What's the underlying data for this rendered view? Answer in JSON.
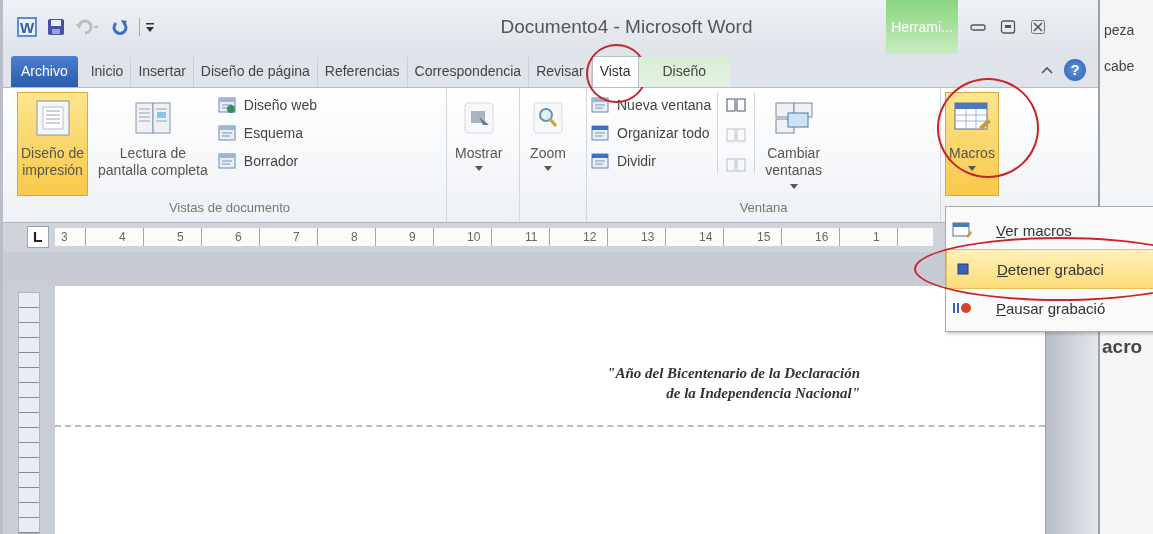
{
  "window": {
    "title": "Documento4 - Microsoft Word",
    "app_icon_letter": "W"
  },
  "contextual_tab_group": {
    "label": "Herrami..."
  },
  "tabs": [
    {
      "label": "Archivo",
      "kind": "file",
      "selected": false,
      "circled": false
    },
    {
      "label": "Inicio",
      "kind": "normal",
      "selected": false,
      "circled": false
    },
    {
      "label": "Insertar",
      "kind": "normal",
      "selected": false,
      "circled": false
    },
    {
      "label": "Diseño de página",
      "kind": "normal",
      "selected": false,
      "circled": false
    },
    {
      "label": "Referencias",
      "kind": "normal",
      "selected": false,
      "circled": false
    },
    {
      "label": "Correspondencia",
      "kind": "normal",
      "selected": false,
      "circled": false
    },
    {
      "label": "Revisar",
      "kind": "normal",
      "selected": false,
      "circled": false
    },
    {
      "label": "Vista",
      "kind": "normal",
      "selected": true,
      "circled": true
    },
    {
      "label": "Diseño",
      "kind": "contextual",
      "selected": false,
      "circled": false
    }
  ],
  "help": "?",
  "ribbon": {
    "groups": [
      {
        "label": "Vistas de documento",
        "columns": [
          {
            "kind": "large",
            "label": "Diseño de\nimpresión",
            "pressed": true,
            "dropdown": false,
            "circled": false
          },
          {
            "kind": "large",
            "label": "Lectura de\npantalla completa",
            "pressed": false,
            "dropdown": false,
            "circled": false
          },
          {
            "kind": "stack",
            "items": [
              {
                "label": "Diseño web"
              },
              {
                "label": "Esquema"
              },
              {
                "label": "Borrador"
              }
            ]
          }
        ]
      },
      {
        "columns": [
          {
            "kind": "large",
            "label": "Mostrar",
            "pressed": false,
            "dropdown": true,
            "circled": false
          }
        ]
      },
      {
        "columns": [
          {
            "kind": "large",
            "label": "Zoom",
            "pressed": false,
            "dropdown": true,
            "circled": false
          }
        ]
      },
      {
        "label": "Ventana",
        "columns": [
          {
            "kind": "stack",
            "items": [
              {
                "label": "Nueva ventana"
              },
              {
                "label": "Organizar todo"
              },
              {
                "label": "Dividir"
              }
            ]
          },
          {
            "kind": "icon_stack",
            "items": [
              {
                "disabled": false
              },
              {
                "disabled": true
              },
              {
                "disabled": true
              }
            ]
          },
          {
            "kind": "large",
            "label": "Cambiar\nventanas",
            "pressed": false,
            "dropdown": true,
            "circled": false
          }
        ]
      },
      {
        "columns": [
          {
            "kind": "large",
            "label": "Macros",
            "pressed": true,
            "dropdown": true,
            "circled": true
          }
        ]
      }
    ]
  },
  "ruler": {
    "labels": [
      "3",
      "4",
      "5",
      "6",
      "7",
      "8",
      "9",
      "10",
      "11",
      "12",
      "13",
      "14",
      "15",
      "16",
      "1"
    ]
  },
  "macro_menu": {
    "items": [
      {
        "label": "Ver macros",
        "selected": false,
        "circled": false
      },
      {
        "label": "Detener grabaci",
        "selected": true,
        "circled": true
      },
      {
        "label": "Pausar grabació",
        "selected": false,
        "circled": false
      }
    ]
  },
  "document": {
    "header_text": "\"Año del Bicentenario de la Declaración\nde la Independencia Nacional\""
  },
  "background_window": {
    "texts": [
      "peza",
      "cabe",
      "acro"
    ]
  }
}
